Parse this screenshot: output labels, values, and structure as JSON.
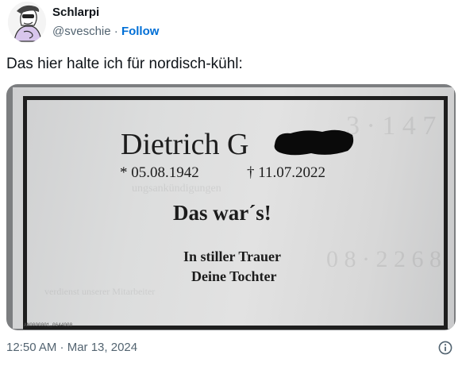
{
  "author": {
    "name": "Schlarpi",
    "handle": "@sveschie",
    "separator": " · ",
    "follow_label": "Follow"
  },
  "tweet": {
    "text": "Das hier halte ich für nordisch-kühl:"
  },
  "media": {
    "deceased_name_visible": "Dietrich G",
    "born": "* 05.08.1942",
    "died": "† 11.07.2022",
    "headline": "Das war´s!",
    "mourning_line1": "In stiller Trauer",
    "mourning_line2": "Deine Tochter",
    "print_code": "AN0000001_0644000"
  },
  "footer": {
    "timestamp": "12:50 AM · Mar 13, 2024",
    "info_icon": "info-icon"
  }
}
